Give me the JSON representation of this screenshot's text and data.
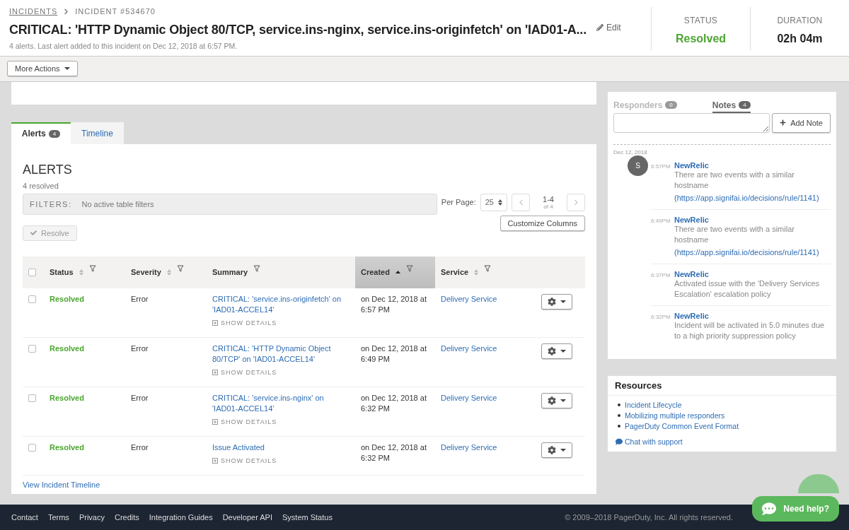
{
  "breadcrumb": {
    "parent": "INCIDENTS",
    "current": "INCIDENT #534670"
  },
  "incident": {
    "title": "CRITICAL: 'HTTP Dynamic Object 80/TCP, service.ins-nginx, service.ins-originfetch' on 'IAD01-A...",
    "edit": "Edit",
    "subtitle": "4 alerts. Last alert added to this incident on Dec 12, 2018 at 6:57 PM."
  },
  "stats": [
    {
      "label": "STATUS",
      "value": "Resolved",
      "kind": "status"
    },
    {
      "label": "DURATION",
      "value": "02h 04m",
      "kind": "plain"
    }
  ],
  "more_actions": "More Actions",
  "tabs": [
    {
      "label": "Alerts",
      "count": "4",
      "selected": true
    },
    {
      "label": "Timeline",
      "selected": false
    }
  ],
  "alerts": {
    "heading": "ALERTS",
    "summary": "4 resolved",
    "filters_label": "FILTERS:",
    "filters_value": "No active table filters",
    "resolve": "Resolve",
    "per_page_label": "Per Page:",
    "per_page": "25",
    "range": "1-4",
    "range_total": "of 4",
    "customize": "Customize Columns",
    "select_all_checked": false,
    "columns": [
      {
        "label": "Status",
        "sortable": true,
        "sorted": false
      },
      {
        "label": "Severity",
        "sortable": true,
        "sorted": false
      },
      {
        "label": "Summary",
        "sortable": false,
        "sorted": false
      },
      {
        "label": "Created",
        "sortable": true,
        "sorted": true
      },
      {
        "label": "Service",
        "sortable": true,
        "sorted": false
      }
    ],
    "rows": [
      {
        "checked": false,
        "status": "Resolved",
        "severity": "Error",
        "summary": "CRITICAL: 'service.ins-originfetch' on 'IAD01-ACCEL14'",
        "details": "SHOW DETAILS",
        "created": "on Dec 12, 2018 at 6:57 PM",
        "service": "Delivery Service"
      },
      {
        "checked": false,
        "status": "Resolved",
        "severity": "Error",
        "summary": "CRITICAL: 'HTTP Dynamic Object 80/TCP' on 'IAD01-ACCEL14'",
        "details": "SHOW DETAILS",
        "created": "on Dec 12, 2018 at 6:49 PM",
        "service": "Delivery Service"
      },
      {
        "checked": false,
        "status": "Resolved",
        "severity": "Error",
        "summary": "CRITICAL: 'service.ins-nginx' on 'IAD01-ACCEL14'",
        "details": "SHOW DETAILS",
        "created": "on Dec 12, 2018 at 6:32 PM",
        "service": "Delivery Service"
      },
      {
        "checked": false,
        "status": "Resolved",
        "severity": "Error",
        "summary": "Issue Activated",
        "details": "SHOW DETAILS",
        "created": "on Dec 12, 2018 at 6:32 PM",
        "service": "Delivery Service"
      }
    ],
    "footer_link": "View Incident Timeline"
  },
  "side_tabs": [
    {
      "label": "Responders",
      "count": "0",
      "selected": false
    },
    {
      "label": "Notes",
      "count": "4",
      "selected": true
    }
  ],
  "add_note": "Add Note",
  "notes_date": "Dec 12, 2018",
  "notes": [
    {
      "avatar": "S",
      "time": "6:57PM",
      "author": "NewRelic",
      "text": "There are two events with a similar hostname",
      "link": "(https://app.signifai.io/decisions/rule/1141)"
    },
    {
      "time": "6:49PM",
      "author": "NewRelic",
      "text": "There are two events with a similar hostname",
      "link": "(https://app.signifai.io/decisions/rule/1141)"
    },
    {
      "time": "6:37PM",
      "author": "NewRelic",
      "text": "Activated issue with the 'Delivery Services Escalation' escalation policy"
    },
    {
      "time": "6:32PM",
      "author": "NewRelic",
      "text": "Incident will be activated in 5.0 minutes due to a high priority suppression policy"
    }
  ],
  "resources": {
    "title": "Resources",
    "links": [
      "Incident Lifecycle",
      "Mobilizing multiple responders",
      "PagerDuty Common Event Format"
    ],
    "chat": "Chat with support"
  },
  "footer": {
    "links": [
      "Contact",
      "Terms",
      "Privacy",
      "Credits",
      "Integration Guides",
      "Developer API",
      "System Status"
    ],
    "copyright": "© 2009–2018 PagerDuty, Inc. All rights reserved."
  },
  "need_help": "Need help?"
}
